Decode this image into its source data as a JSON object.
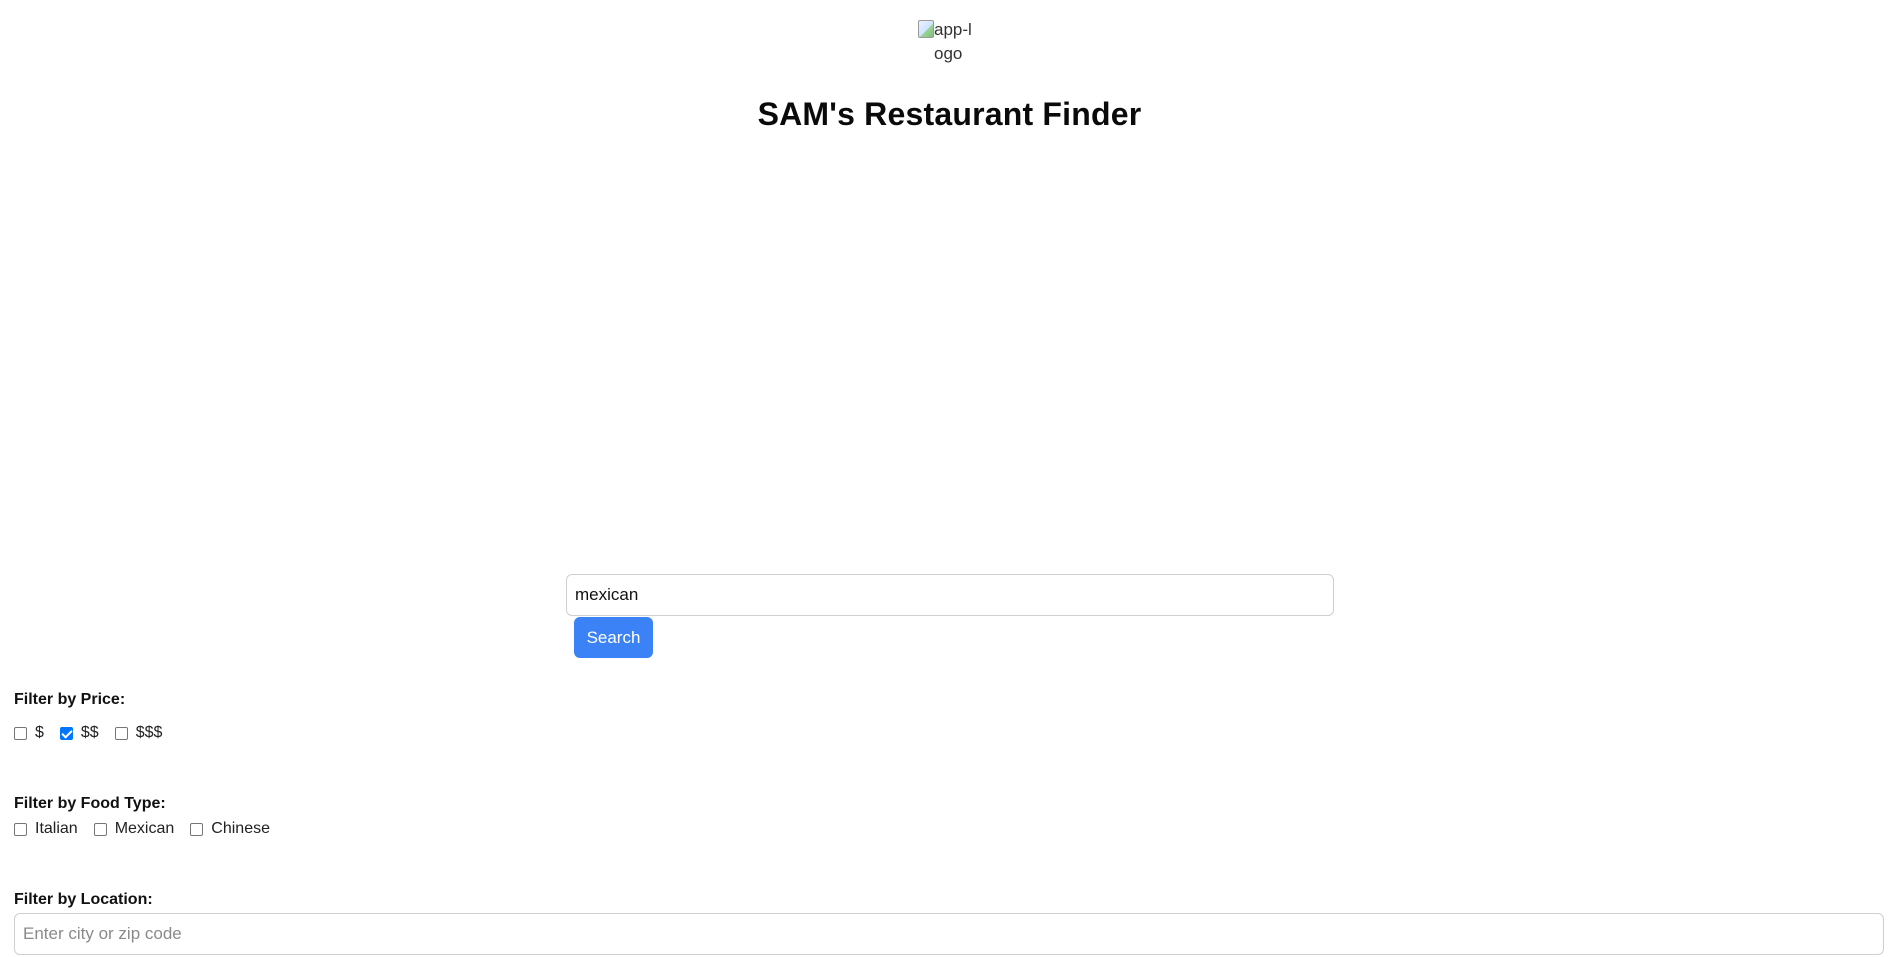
{
  "header": {
    "logo_alt": "app-logo",
    "title": "SAM's Restaurant Finder"
  },
  "search": {
    "value": "mexican",
    "button_label": "Search"
  },
  "filters": {
    "price": {
      "label": "Filter by Price:",
      "options": [
        {
          "label": "$",
          "checked": false
        },
        {
          "label": "$$",
          "checked": true
        },
        {
          "label": "$$$",
          "checked": false
        }
      ]
    },
    "food_type": {
      "label": "Filter by Food Type:",
      "options": [
        {
          "label": "Italian",
          "checked": false
        },
        {
          "label": "Mexican",
          "checked": false
        },
        {
          "label": "Chinese",
          "checked": false
        }
      ]
    },
    "location": {
      "label": "Filter by Location:",
      "placeholder": "Enter city or zip code",
      "value": ""
    }
  },
  "colors": {
    "accent": "#3b82f6",
    "checkbox_checked": "#0075ff"
  }
}
